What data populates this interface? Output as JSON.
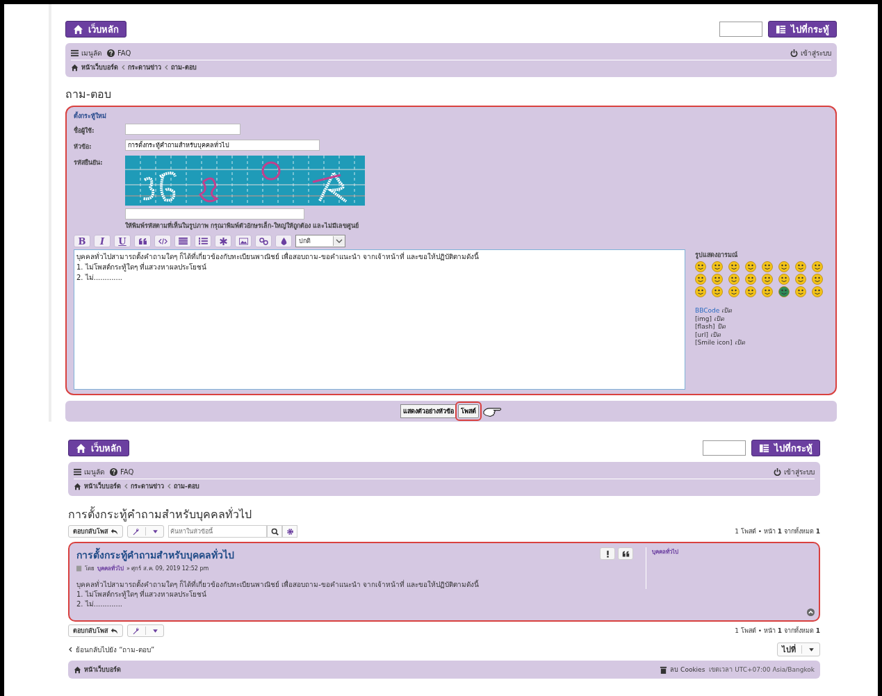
{
  "top": {
    "header": {
      "home_button": "เว็บหลัก",
      "jump_button": "ไปที่กระทู้"
    },
    "navbar": {
      "menu": "เมนูลัด",
      "faq": "FAQ",
      "login": "เข้าสู่ระบบ",
      "breadcrumbs": [
        "หน้าเว็บบอร์ด",
        "กระดานข่าว",
        "ถาม-ตอบ"
      ]
    },
    "page_title": "ถาม-ตอบ",
    "form": {
      "highlighted": true,
      "legend": "ตั้งกระทู้ใหม่",
      "fields": [
        {
          "label": "ชื่อผู้ใช้:",
          "kind": "short"
        },
        {
          "label": "หัวข้อ:",
          "value": "การตั้งกระทู้คำถามสำหรับบุคคลทั่วไป",
          "kind": "long"
        }
      ],
      "captcha": {
        "label": "รหัสยืนยัน:",
        "hint": "ให้พิมพ์รหัสตามที่เห็นในรูปภาพ กรุณาพิมพ์ตัวอักษรเล็ก-ใหญ่ให้ถูกต้อง และไม่มีเลขศูนย์"
      },
      "toolbar": [
        {
          "kind": "bold",
          "label": "B"
        },
        {
          "kind": "italic",
          "label": "I"
        },
        {
          "kind": "underline",
          "label": "U"
        },
        {
          "kind": "quote"
        },
        {
          "kind": "code"
        },
        {
          "kind": "list"
        },
        {
          "kind": "numbered-list"
        },
        {
          "kind": "list-item"
        },
        {
          "kind": "image"
        },
        {
          "kind": "link"
        },
        {
          "kind": "color"
        }
      ],
      "font_size": "ปกติ",
      "message": [
        "บุคคลทั่วไปสามารถตั้งคำถามใดๆ ก็ได้ที่เกี่ยวข้องกับทะเบียนพาณิชย์ เพื่อสอบถาม-ขอคำแนะนำ จากเจ้าหน้าที่ และขอให้ปฏิบัติตามดังนี้",
        "1. ไม่โพสต์กระทู้ใดๆ ที่แสวงหาผลประโยชน์",
        "2. ไม่............."
      ],
      "smilies_heading": "รูปแสดงอารมณ์",
      "options": [
        {
          "label": "BBCode",
          "status": "เปิด",
          "link": true
        },
        {
          "label": "[img]",
          "status": "เปิด",
          "link": false
        },
        {
          "label": "[flash]",
          "status": "ปิด",
          "link": false
        },
        {
          "label": "[url]",
          "status": "เปิด",
          "link": false
        },
        {
          "label": "[Smile icon]",
          "status": "เปิด",
          "link": false
        }
      ]
    },
    "submit_buttons": [
      {
        "label": "แสดงตัวอย่างหัวข้อ",
        "highlighted": false
      },
      {
        "label": "โพสต์",
        "highlighted": true
      }
    ]
  },
  "bottom": {
    "header": {
      "home_button": "เว็บหลัก",
      "jump_button": "ไปที่กระทู้"
    },
    "navbar": {
      "menu": "เมนูลัด",
      "faq": "FAQ",
      "login": "เข้าสู่ระบบ",
      "breadcrumbs": [
        "หน้าเว็บบอร์ด",
        "กระดานข่าว",
        "ถาม-ตอบ"
      ]
    },
    "topic_title": "การตั้งกระทู้คำถามสำหรับบุคคลทั่วไป",
    "reply_button": "ตอบกลับโพส",
    "search": {
      "placeholder": "ค้นหาในหัวข้อนี้"
    },
    "pagination_top": "1 โพสต์ • หน้า **1** จากทั้งหมด **1**",
    "post": {
      "highlighted": true,
      "title": "การตั้งกระทู้คำถามสำหรับบุคคลทั่วไป",
      "by": "โดย",
      "author": "บุคคลทั่วไป",
      "date": "» ศุกร์ ส.ค. 09, 2019 12:52 pm",
      "body": [
        "บุคคลทั่วไปสามารถตั้งคำถามใดๆ ก็ได้ที่เกี่ยวข้องกับทะเบียนพาณิชย์ เพื่อสอบถาม-ขอคำแนะนำ จากเจ้าหน้าที่ และขอให้ปฏิบัติตามดังนี้",
        "1. ไม่โพสต์กระทู้ใดๆ ที่แสวงหาผลประโยชน์",
        "2. ไม่............."
      ],
      "profile_name": "บุคคลทั่วไป"
    },
    "reply_button_bottom": "ตอบกลับโพส",
    "pagination_bottom": "1 โพสต์ • หน้า **1** จากทั้งหมด **1**",
    "back_link": "ย้อนกลับไปยัง “ถาม-ตอบ”",
    "jump_button": "ไปที่",
    "footer": {
      "home": "หน้าเว็บบอร์ด",
      "cookies": "ลบ Cookies",
      "timezone": "เขตเวลา UTC+07:00 Asia/Bangkok"
    }
  }
}
